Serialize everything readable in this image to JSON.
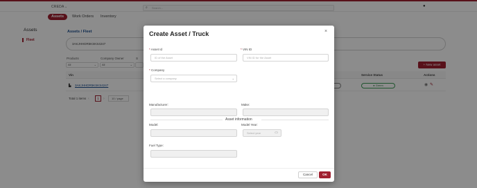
{
  "app": {
    "brand": "CREDA",
    "search_placeholder": "Search...",
    "nav_tabs": [
      "Assets",
      "Work Orders",
      "Inventory"
    ]
  },
  "sidebar": {
    "title": "Assets",
    "items": [
      "Fleet"
    ]
  },
  "main": {
    "breadcrumb": "Assets / Fleet",
    "vin_search_value": "3AKJHHDR5KSKS4247",
    "filters": [
      {
        "label": "Products",
        "value": "All"
      },
      {
        "label": "Company Owner",
        "value": "All"
      },
      {
        "label": "S",
        "value": ""
      }
    ],
    "new_asset_label": "+  New asset",
    "table": {
      "headers": [
        "Vin",
        "Service Status",
        "Actions"
      ],
      "rows": [
        {
          "vin": "3AKJHHDR5KSKS4247",
          "service_status": "Green"
        }
      ]
    },
    "pagination": {
      "total": "Total 1 items",
      "current_page": "1",
      "page_size": "10 / page"
    }
  },
  "modal": {
    "title": "Create Asset / Truck",
    "close_label": "×",
    "fields": {
      "asset_id": {
        "label": "Asset Id",
        "placeholder": "ID of the Asset",
        "required": true
      },
      "vin_id": {
        "label": "VIN ID",
        "placeholder": "VIN ID for the Asset",
        "required": true
      },
      "company": {
        "label": "Company",
        "placeholder": "Select a company",
        "required": true
      },
      "manufacturer": {
        "label": "Manufacturer:"
      },
      "make": {
        "label": "Make:"
      },
      "model": {
        "label": "Model:"
      },
      "model_year": {
        "label": "Model Year:",
        "placeholder": "Select year"
      },
      "fuel_type": {
        "label": "Fuel Type:"
      }
    },
    "section_title": "Asset information",
    "cancel_label": "Cancel",
    "ok_label": "OK"
  },
  "colors": {
    "accent": "#a02030",
    "link": "#1a4d8f",
    "status_green": "#3a9a55"
  }
}
